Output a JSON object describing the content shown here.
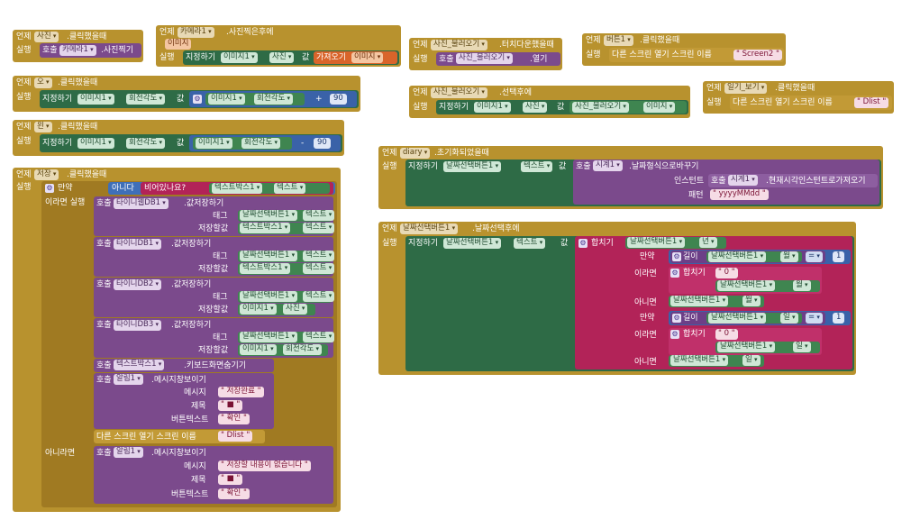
{
  "common": {
    "when": "언제",
    "do": "실행",
    "call": "호출",
    "set": "지정하기",
    "value": "값",
    "if": "만약",
    "then": "이라면 실행",
    "else": "아니라면",
    "then2": "이라면",
    "else2": "아니면",
    "tag": "태그",
    "store": "저장할값",
    "message": "메시지",
    "title": "제목",
    "button_text": "버튼텍스트",
    "open_screen": "다른 스크린 열기  스크린 이름",
    "not": "아니다",
    "is_empty": "비어있나요?",
    "join": "합치기",
    "length": "길이",
    "instant": "인스턴트",
    "pattern": "패턴",
    "eq": "=",
    "plus": "+",
    "minus": "-"
  },
  "blocks": {
    "camera_click": {
      "comp": "사진",
      "event": ".클릭했을때",
      "call_comp": "카메라1",
      "call_method": ".사진찍기"
    },
    "after_picture": {
      "comp": "카메라1",
      "event": ".사진찍은후에",
      "param": "이미지",
      "target": "이미지1",
      "prop": "사진",
      "get": "가져오기",
      "get_var": "이미지"
    },
    "right_click": {
      "comp": "오",
      "event": ".클릭했을때",
      "target": "이미지1",
      "prop": "회전각도",
      "get_comp": "이미지1",
      "get_prop": "회전각도",
      "num": "90"
    },
    "left_click": {
      "comp": "왼",
      "event": ".클릭했을때",
      "target": "이미지1",
      "prop": "회전각도",
      "get_comp": "이미지1",
      "get_prop": "회전각도",
      "num": "90"
    },
    "save_click": {
      "comp": "저장",
      "event": ".클릭했을때",
      "cond_comp": "텍스트박스1",
      "cond_prop": "텍스트",
      "db": [
        {
          "comp": "타이니웹DB1",
          "method": ".값저장하기",
          "tag_comp": "날짜선택버튼1",
          "tag_prop": "텍스트",
          "val_comp": "텍스트박스1",
          "val_prop": "텍스트"
        },
        {
          "comp": "타이니DB1",
          "method": ".값저장하기",
          "tag_comp": "날짜선택버튼1",
          "tag_prop": "텍스트",
          "val_comp": "텍스트박스1",
          "val_prop": "텍스트"
        },
        {
          "comp": "타이니DB2",
          "method": ".값저장하기",
          "tag_comp": "날짜선택버튼1",
          "tag_prop": "텍스트",
          "val_comp": "이미지1",
          "val_prop": "사진"
        },
        {
          "comp": "타이니DB3",
          "method": ".값저장하기",
          "tag_comp": "날짜선택버튼1",
          "tag_prop": "텍스트",
          "val_comp": "이미지1",
          "val_prop": "회전각도"
        }
      ],
      "hide_comp": "텍스트박스1",
      "hide_method": ".키보드화면숨기기",
      "alert_comp": "알림1",
      "alert_method": ".메시지창보이기",
      "msg1": "\" 저장완료 \"",
      "empty": "\" ■ \"",
      "ok": "\" 확인 \"",
      "screen": "\" Dlist \"",
      "msg2": "\" 저장할 내용이 없습니다 \""
    },
    "gallery_touch": {
      "comp": "사진_불러오기",
      "event": ".터치다운했을때",
      "call_comp": "사진_불러오기",
      "call_method": ".열기"
    },
    "gallery_after": {
      "comp": "사진_불러오기",
      "event": ".선택후에",
      "target": "이미지1",
      "prop": "사진",
      "get_comp": "사진_불러오기",
      "get_prop": "이미지"
    },
    "button1_click": {
      "comp": "버튼1",
      "event": ".클릭했을때",
      "screen": "\" Screen2 \""
    },
    "bottom_click": {
      "comp": "일기_보기",
      "event": ".클릭했을때",
      "screen": "\" Dlist \""
    },
    "diary_init": {
      "comp": "diary",
      "event": ".초기화되었을때",
      "target": "날짜선택버튼1",
      "prop": "텍스트",
      "clock": "시계1",
      "fmt_method": ".날짜형식으로바꾸기",
      "now_method": ".현재시각인스턴트로가져오기",
      "pattern": "\" yyyyMMdd \""
    },
    "date_after": {
      "comp": "날짜선택버튼1",
      "event": ".날짜선택후에",
      "target": "날짜선택버튼1",
      "prop": "텍스트",
      "src": "날짜선택버튼1",
      "year": "년",
      "month": "월",
      "day": "일",
      "one": "1",
      "zero": "\" 0 \""
    }
  }
}
